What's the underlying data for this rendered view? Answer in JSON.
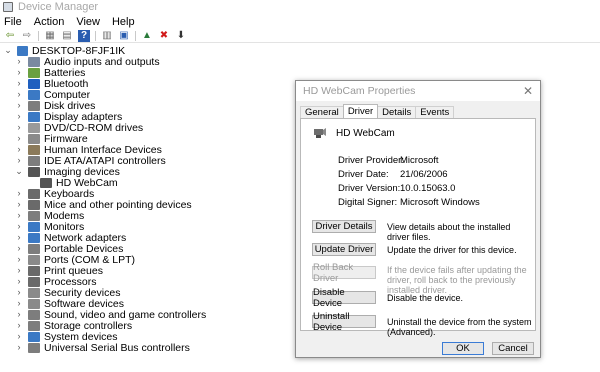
{
  "window": {
    "title": "Device Manager"
  },
  "menu": [
    "File",
    "Action",
    "View",
    "Help"
  ],
  "toolbar": {
    "icons": [
      "back-arrow-icon",
      "forward-arrow-icon",
      "properties-grid-icon",
      "document-icon",
      "help-icon",
      "device-tree-icon",
      "monitor-scan-icon",
      "enable-device-icon",
      "uninstall-x-icon",
      "update-driver-icon"
    ],
    "glyphs": [
      "⇦",
      "⇨",
      "▦",
      "▤",
      "?",
      "▥",
      "▣",
      "▲",
      "✖",
      "⬇"
    ],
    "colors": [
      "#5b8a1d",
      "#7a7a7a",
      "#6a6a6a",
      "#6a6a6a",
      "#2a5db0",
      "#6a6a6a",
      "#2a5db0",
      "#2a7a3a",
      "#d11a1a",
      "#333333"
    ]
  },
  "tree": {
    "root": "DESKTOP-8FJF1IK",
    "items": [
      {
        "label": "Audio inputs and outputs",
        "expanded": false,
        "level": 1,
        "color": "#7a8aa0"
      },
      {
        "label": "Batteries",
        "expanded": false,
        "level": 1,
        "color": "#6aa040"
      },
      {
        "label": "Bluetooth",
        "expanded": false,
        "level": 1,
        "color": "#1f5fbf"
      },
      {
        "label": "Computer",
        "expanded": false,
        "level": 1,
        "color": "#3b79c4"
      },
      {
        "label": "Disk drives",
        "expanded": false,
        "level": 1,
        "color": "#7d7d7d"
      },
      {
        "label": "Display adapters",
        "expanded": false,
        "level": 1,
        "color": "#3b79c4"
      },
      {
        "label": "DVD/CD-ROM drives",
        "expanded": false,
        "level": 1,
        "color": "#9a9a9a"
      },
      {
        "label": "Firmware",
        "expanded": false,
        "level": 1,
        "color": "#8a8a8a"
      },
      {
        "label": "Human Interface Devices",
        "expanded": false,
        "level": 1,
        "color": "#8b7a5a"
      },
      {
        "label": "IDE ATA/ATAPI controllers",
        "expanded": false,
        "level": 1,
        "color": "#7d7d7d"
      },
      {
        "label": "Imaging devices",
        "expanded": true,
        "level": 1,
        "color": "#555555"
      },
      {
        "label": "HD WebCam",
        "expanded": null,
        "level": 2,
        "color": "#555555"
      },
      {
        "label": "Keyboards",
        "expanded": false,
        "level": 1,
        "color": "#6a6a6a"
      },
      {
        "label": "Mice and other pointing devices",
        "expanded": false,
        "level": 1,
        "color": "#6a6a6a"
      },
      {
        "label": "Modems",
        "expanded": false,
        "level": 1,
        "color": "#7d7d7d"
      },
      {
        "label": "Monitors",
        "expanded": false,
        "level": 1,
        "color": "#3b79c4"
      },
      {
        "label": "Network adapters",
        "expanded": false,
        "level": 1,
        "color": "#3b79c4"
      },
      {
        "label": "Portable Devices",
        "expanded": false,
        "level": 1,
        "color": "#7d7d7d"
      },
      {
        "label": "Ports (COM & LPT)",
        "expanded": false,
        "level": 1,
        "color": "#8a8a8a"
      },
      {
        "label": "Print queues",
        "expanded": false,
        "level": 1,
        "color": "#6a6a6a"
      },
      {
        "label": "Processors",
        "expanded": false,
        "level": 1,
        "color": "#6a6a6a"
      },
      {
        "label": "Security devices",
        "expanded": false,
        "level": 1,
        "color": "#8a8a8a"
      },
      {
        "label": "Software devices",
        "expanded": false,
        "level": 1,
        "color": "#8a8a8a"
      },
      {
        "label": "Sound, video and game controllers",
        "expanded": false,
        "level": 1,
        "color": "#7d7d7d"
      },
      {
        "label": "Storage controllers",
        "expanded": false,
        "level": 1,
        "color": "#7d7d7d"
      },
      {
        "label": "System devices",
        "expanded": false,
        "level": 1,
        "color": "#3b79c4"
      },
      {
        "label": "Universal Serial Bus controllers",
        "expanded": false,
        "level": 1,
        "color": "#7d7d7d"
      }
    ]
  },
  "dialog": {
    "title": "HD WebCam Properties",
    "close": "✕",
    "tabs": [
      "General",
      "Driver",
      "Details",
      "Events"
    ],
    "active_tab": "Driver",
    "device_name": "HD WebCam",
    "info": [
      {
        "label": "Driver Provider:",
        "value": "Microsoft"
      },
      {
        "label": "Driver Date:",
        "value": "21/06/2006"
      },
      {
        "label": "Driver Version:",
        "value": "10.0.15063.0"
      },
      {
        "label": "Digital Signer:",
        "value": "Microsoft Windows"
      }
    ],
    "actions": [
      {
        "button": "Driver Details",
        "desc": "View details about the installed driver files.",
        "enabled": true
      },
      {
        "button": "Update Driver",
        "desc": "Update the driver for this device.",
        "enabled": true
      },
      {
        "button": "Roll Back Driver",
        "desc": "If the device fails after updating the driver, roll back to the previously installed driver.",
        "enabled": false
      },
      {
        "button": "Disable Device",
        "desc": "Disable the device.",
        "enabled": true
      },
      {
        "button": "Uninstall Device",
        "desc": "Uninstall the device from the system (Advanced).",
        "enabled": true
      }
    ],
    "ok": "OK",
    "cancel": "Cancel"
  }
}
